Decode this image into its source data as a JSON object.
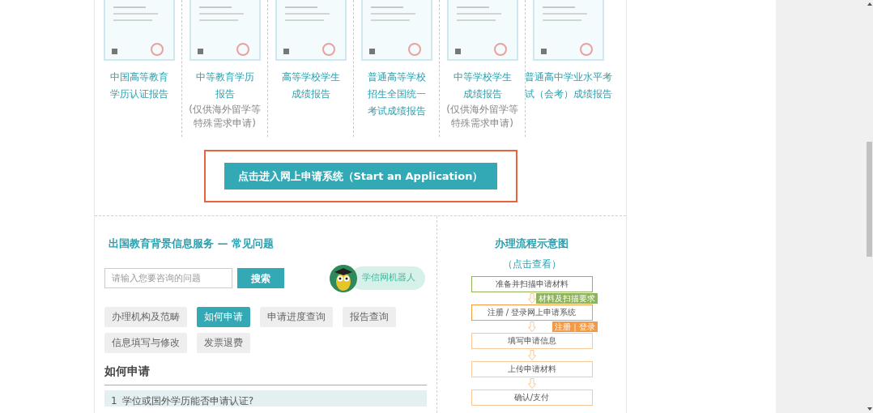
{
  "documents": [
    {
      "title_lines": [
        "中国高等教育",
        "学历认证报告"
      ]
    },
    {
      "title_lines": [
        "中等教育学历",
        "报告"
      ],
      "note_lines": [
        "(仅供海外留学等",
        "特殊需求申请)"
      ]
    },
    {
      "title_lines": [
        "高等学校学生",
        "成绩报告"
      ]
    },
    {
      "title_lines": [
        "普通高等学校",
        "招生全国统一",
        "考试成绩报告"
      ]
    },
    {
      "title_lines": [
        "中等学校学生",
        "成绩报告"
      ],
      "note_lines": [
        "(仅供海外留学等",
        "特殊需求申请)"
      ]
    },
    {
      "title_lines": [
        "普通高中学业水平考",
        "试（会考）成绩报告"
      ]
    }
  ],
  "start_button": "点击进入网上申请系统（Start an Application）",
  "faq": {
    "title": "出国教育背景信息服务 — 常见问题",
    "search": {
      "placeholder": "请输入您要咨询的问题",
      "button": "搜索"
    },
    "robot": "学信网机器人",
    "tabs": [
      {
        "label": "办理机构及范畴",
        "selected": false
      },
      {
        "label": "如何申请",
        "selected": true
      },
      {
        "label": "申请进度查询",
        "selected": false
      },
      {
        "label": "报告查询",
        "selected": false
      },
      {
        "label": "信息填写与修改",
        "selected": false
      },
      {
        "label": "发票退费",
        "selected": false
      }
    ],
    "heading": "如何申请",
    "items": [
      {
        "number": "1",
        "question": "学位或国外学历能否申请认证?"
      }
    ]
  },
  "flow": {
    "title": "办理流程示意图",
    "subtitle": "（点击查看）",
    "steps": [
      {
        "label": "准备并扫描申请材料",
        "tag": "材料及扫描要求",
        "color": "#8fb35a"
      },
      {
        "label": "注册 / 登录网上申请系统",
        "tag": "注册｜登录",
        "color": "#f39a45"
      },
      {
        "label": "填写申请信息",
        "color": "#f6c89a"
      },
      {
        "label": "上传申请材料",
        "color": "#f6c89a"
      },
      {
        "label": "确认/支付",
        "color": "#f6c89a"
      }
    ]
  }
}
